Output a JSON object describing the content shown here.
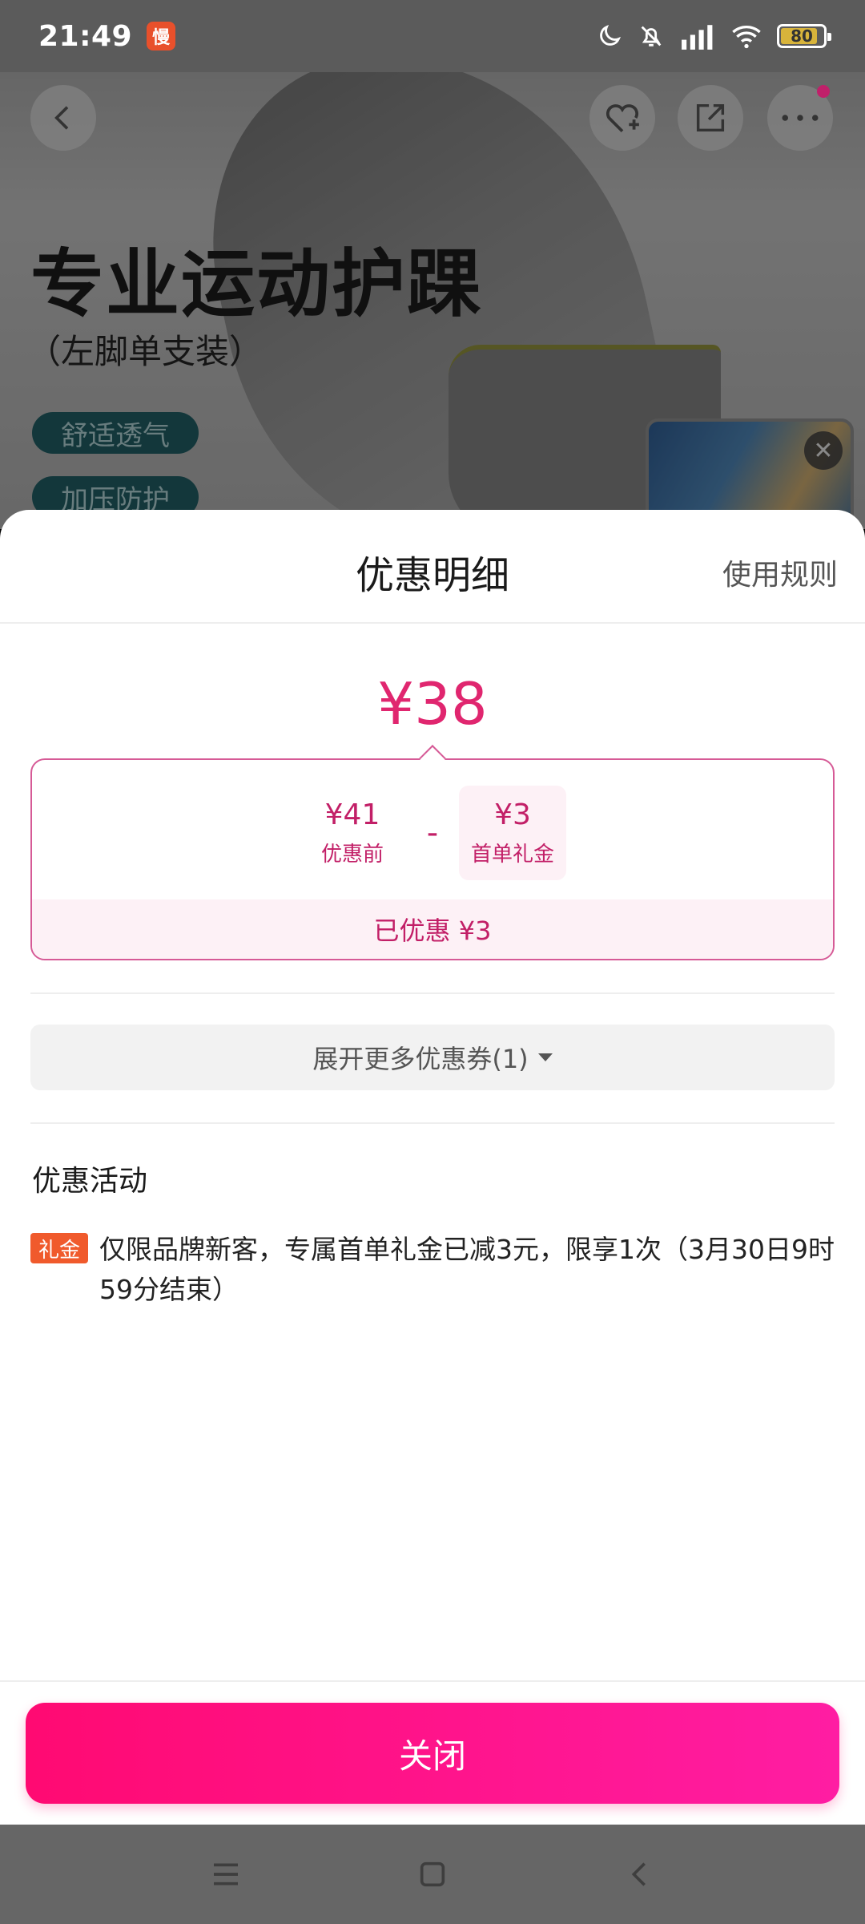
{
  "status_bar": {
    "time": "21:49",
    "app_badge": "慢",
    "battery": "80"
  },
  "background": {
    "title": "专业运动护踝",
    "subtitle": "（左脚单支装）",
    "tags": [
      "舒适透气",
      "加压防护"
    ]
  },
  "sheet": {
    "title": "优惠明细",
    "rules_link": "使用规则",
    "final_price": "¥38",
    "calc": {
      "original_value": "¥41",
      "original_label": "优惠前",
      "operator": "-",
      "discount_value": "¥3",
      "discount_label": "首单礼金",
      "saved_text": "已优惠 ¥3"
    },
    "expand_label": "展开更多优惠券(1)",
    "activity_title": "优惠活动",
    "promo": {
      "badge": "礼金",
      "text": "仅限品牌新客，专属首单礼金已减3元，限享1次（3月30日9时59分结束）"
    },
    "close_label": "关闭"
  },
  "colors": {
    "accent": "#e0266f",
    "button_start": "#ff0a72",
    "button_end": "#ff1da3",
    "badge": "#f05a2c"
  }
}
